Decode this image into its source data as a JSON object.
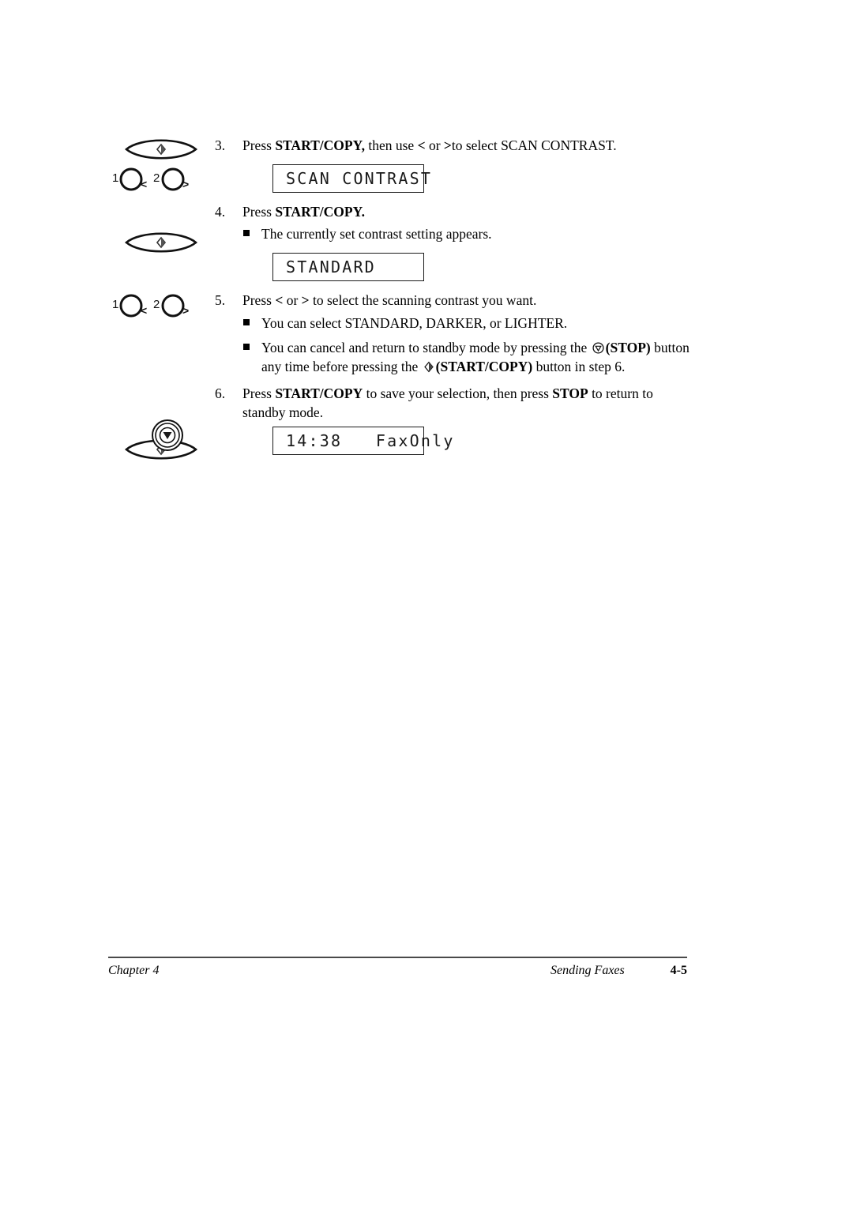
{
  "document": {
    "chapter": "Chapter 4",
    "section": "Sending Faxes",
    "page_number": "4-5"
  },
  "steps": [
    {
      "number": "3.",
      "text_parts": {
        "a": "Press ",
        "b_bold": "START/COPY,",
        "c": " then use ",
        "d_bold": "<",
        "e": " or ",
        "f_bold": ">",
        "g": "to select SCAN CONTRAST."
      }
    },
    {
      "number": "4.",
      "text_parts": {
        "a": "Press ",
        "b_bold": "START/COPY."
      }
    },
    {
      "number": "5.",
      "text_parts": {
        "a": "Press ",
        "b_bold": "<",
        "c": " or ",
        "d_bold": ">",
        "e": " to select the scanning contrast you want."
      }
    },
    {
      "number": "6.",
      "text_parts": {
        "a": "Press ",
        "b_bold": "START/COPY",
        "c": " to save your selection, then press ",
        "d_bold": "STOP",
        "e": " to return to standby mode."
      }
    }
  ],
  "bullets": {
    "contrast_appears": "The currently set contrast setting appears.",
    "can_select": "You can select STANDARD, DARKER, or LIGHTER.",
    "cancel_line1_a": "You can cancel and return to standby mode by pressing the ",
    "cancel_line1_icon": "stop-key-icon",
    "cancel_line1_b": "(STOP)",
    "cancel_line2_a": "button any time before pressing the ",
    "cancel_line2_icon": "start-copy-key-icon",
    "cancel_line2_b": "(START/COPY)",
    "cancel_line2_c": " button in step 6."
  },
  "lcd_displays": [
    {
      "name": "scan-contrast",
      "text": "SCAN CONTRAST"
    },
    {
      "name": "standard",
      "text": "STANDARD"
    },
    {
      "name": "standby",
      "text": "14:38   FaxOnly"
    }
  ],
  "gutter_icons": [
    {
      "name": "start-copy-key-icon",
      "kind": "lens"
    },
    {
      "name": "arrow-keys-icon",
      "kind": "arrows",
      "label_1": "1",
      "label_2": "2",
      "sub_1": "<",
      "sub_2": ">"
    },
    {
      "name": "start-copy-key-icon",
      "kind": "lens"
    },
    {
      "name": "arrow-keys-icon",
      "kind": "arrows",
      "label_1": "1",
      "label_2": "2",
      "sub_1": "<",
      "sub_2": ">"
    },
    {
      "name": "start-copy-key-icon",
      "kind": "lens"
    },
    {
      "name": "stop-key-icon",
      "kind": "stop"
    }
  ]
}
